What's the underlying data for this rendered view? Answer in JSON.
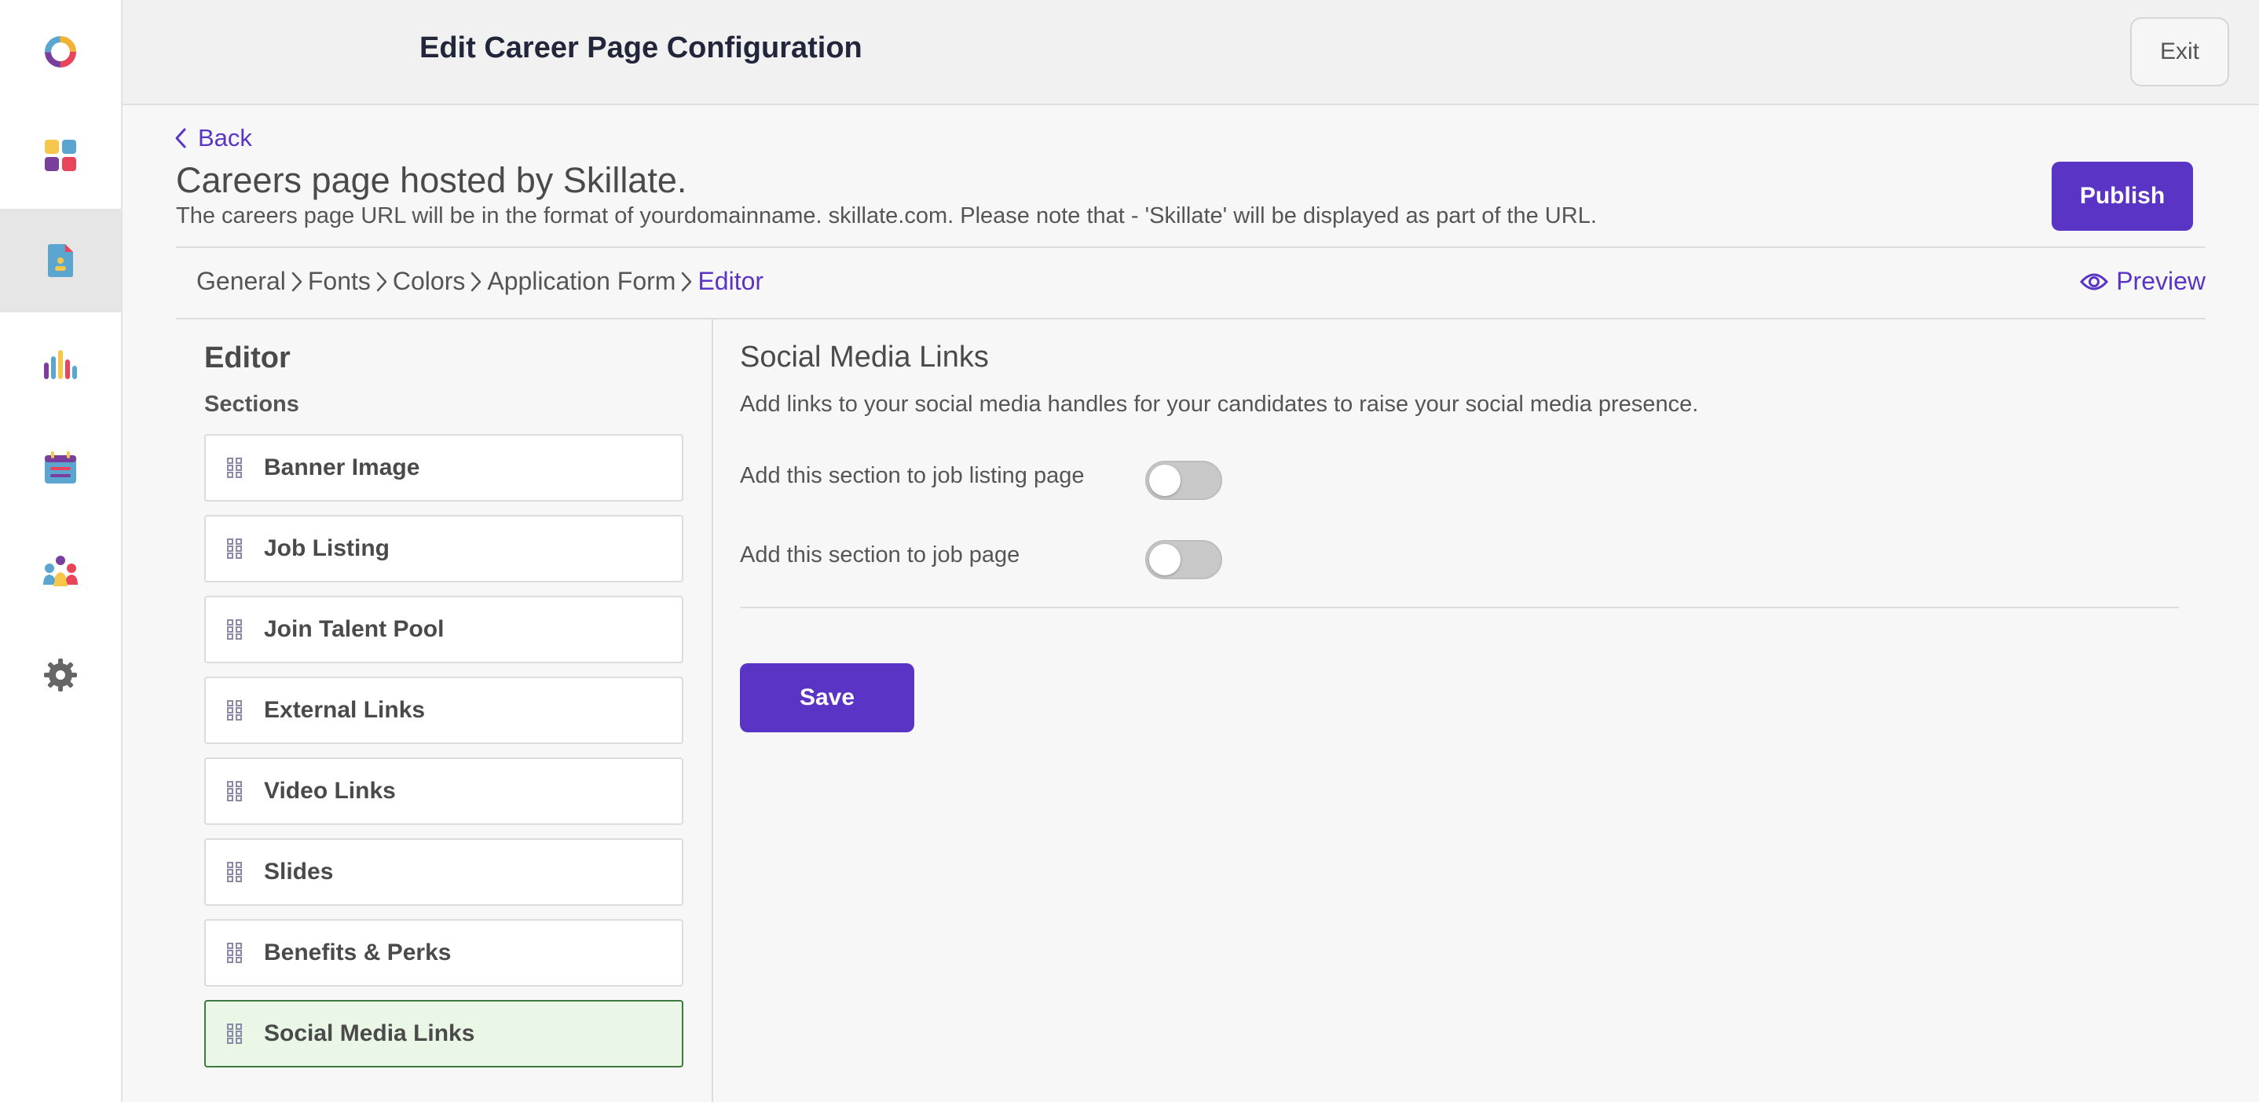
{
  "header": {
    "title": "Edit Career Page Configuration",
    "exit_label": "Exit"
  },
  "rail": {
    "items": [
      {
        "icon": "logo-ring-icon"
      },
      {
        "icon": "dashboard-grid-icon"
      },
      {
        "icon": "career-page-document-icon",
        "active": true
      },
      {
        "icon": "analytics-bars-icon"
      },
      {
        "icon": "calendar-icon"
      },
      {
        "icon": "team-people-icon"
      },
      {
        "icon": "gear-icon"
      }
    ]
  },
  "page": {
    "back_label": "Back",
    "title": "Careers page hosted by Skillate.",
    "description": "The careers page URL will be in the format of yourdomainname. skillate.com. Please note that - 'Skillate' will be displayed as part of the URL.",
    "publish_label": "Publish",
    "preview_label": "Preview"
  },
  "breadcrumb": {
    "items": [
      "General",
      "Fonts",
      "Colors",
      "Application Form",
      "Editor"
    ]
  },
  "editor": {
    "title": "Editor",
    "sections_label": "Sections",
    "sections": [
      {
        "label": "Banner Image"
      },
      {
        "label": "Job Listing"
      },
      {
        "label": "Join Talent Pool"
      },
      {
        "label": "External Links"
      },
      {
        "label": "Video Links"
      },
      {
        "label": "Slides"
      },
      {
        "label": "Benefits & Perks"
      },
      {
        "label": "Social Media Links",
        "active": true
      }
    ]
  },
  "social_media": {
    "title": "Social Media Links",
    "description": "Add links to your social media handles for your candidates to raise your social media presence.",
    "toggles": [
      {
        "label": "Add this section to job listing page",
        "on": false
      },
      {
        "label": "Add this section to job page",
        "on": false
      }
    ],
    "save_label": "Save"
  },
  "colors": {
    "accent": "#5a34c4",
    "active_section_bg": "#eaf7e6",
    "active_section_border": "#3d7a3d"
  }
}
